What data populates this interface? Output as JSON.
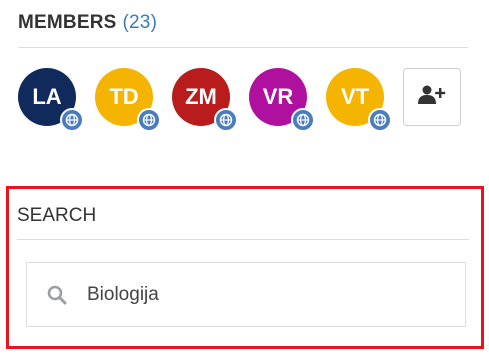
{
  "members": {
    "title": "MEMBERS",
    "count": "(23)",
    "avatars": [
      {
        "initials": "LA",
        "color": "#102a5c"
      },
      {
        "initials": "TD",
        "color": "#f5b400"
      },
      {
        "initials": "ZM",
        "color": "#b81c1c"
      },
      {
        "initials": "VR",
        "color": "#b0109e"
      },
      {
        "initials": "VT",
        "color": "#f5b400"
      }
    ],
    "badge_icon": "globe-icon",
    "add_button_icon": "add-user-icon"
  },
  "search": {
    "title": "SEARCH",
    "value": "Biologija",
    "icon": "search-icon"
  },
  "colors": {
    "accent": "#3a7bbf",
    "badge": "#4a7cc0",
    "highlight": "#e8141c"
  }
}
